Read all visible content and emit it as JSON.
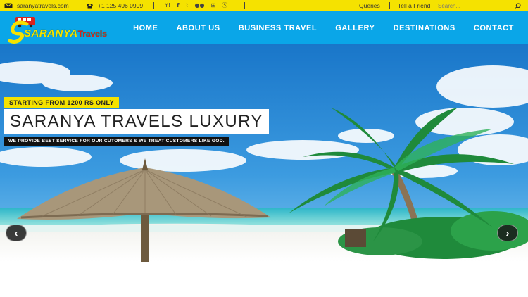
{
  "topbar": {
    "email": "saranyatravels.com",
    "phone": "+1 125 496 0999",
    "social_icons": [
      "yahoo-icon",
      "facebook-icon",
      "rss-icon",
      "flickr-icon",
      "windows-icon",
      "skype-icon"
    ],
    "links": [
      "Queries",
      "Tell a Friend"
    ],
    "search_placeholder": "Search...",
    "background": "#f5e200"
  },
  "header": {
    "logo_text_1": "SARANYA",
    "logo_text_2": "Travels",
    "background": "#0aa6e8",
    "nav": [
      "HOME",
      "ABOUT US",
      "BUSINESS TRAVEL",
      "GALLERY",
      "DESTINATIONS",
      "CONTACT"
    ]
  },
  "hero": {
    "tag": "STARTING FROM 1200 RS ONLY",
    "title": "SARANYA TRAVELS LUXURY",
    "subtitle": "WE PROVIDE BEST SERVICE FOR OUR CUTOMERS & WE TREAT CUSTOMERS LIKE GOD.",
    "prev_label": "‹",
    "next_label": "›"
  }
}
